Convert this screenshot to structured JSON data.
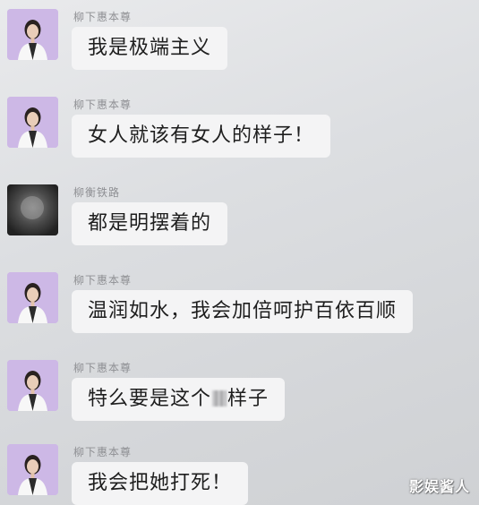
{
  "messages": [
    {
      "sender": "柳下惠本尊",
      "text": "我是极端主义",
      "avatar": "woman-avatar"
    },
    {
      "sender": "柳下惠本尊",
      "text": "女人就该有女人的样子！",
      "avatar": "woman-avatar"
    },
    {
      "sender": "柳衡铁路",
      "text": "都是明摆着的",
      "avatar": "dark-avatar"
    },
    {
      "sender": "柳下惠本尊",
      "text": "温润如水，我会加倍呵护百依百顺",
      "avatar": "woman-avatar"
    },
    {
      "sender": "柳下惠本尊",
      "text_before": "特么要是这个",
      "text_after": "样子",
      "avatar": "woman-avatar"
    },
    {
      "sender": "柳下惠本尊",
      "text": "我会把她打死！",
      "avatar": "woman-avatar"
    }
  ],
  "watermark": "影娱酱人",
  "colors": {
    "avatar_bg": "#cdb8e6",
    "bubble_bg": "#f4f4f5",
    "sender_text": "#8e8f93"
  }
}
